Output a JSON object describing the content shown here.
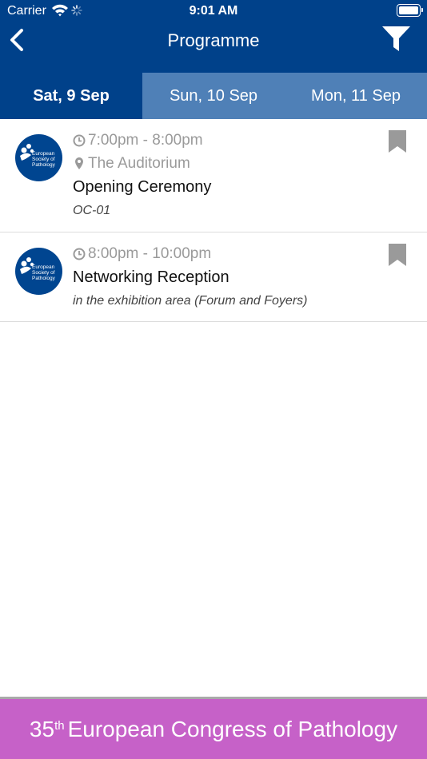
{
  "statusbar": {
    "carrier": "Carrier",
    "time": "9:01 AM"
  },
  "navbar": {
    "title": "Programme",
    "back_icon": "chevron-left-icon",
    "filter_icon": "filter-icon"
  },
  "tabs": [
    {
      "label": "Sat, 9 Sep",
      "active": true
    },
    {
      "label": "Sun, 10 Sep",
      "active": false
    },
    {
      "label": "Mon, 11 Sep",
      "active": false
    }
  ],
  "events": [
    {
      "time": "7:00pm - 8:00pm",
      "location": "The Auditorium",
      "title": "Opening Ceremony",
      "subtitle": "OC-01",
      "logo_text": "European Society of Pathology"
    },
    {
      "time": "8:00pm - 10:00pm",
      "title": "Networking Reception",
      "subtitle": "in the exhibition area (Forum and Foyers)",
      "logo_text": "European Society of Pathology"
    }
  ],
  "footer": {
    "number": "35",
    "ordinal": "th",
    "text": "European Congress of Pathology"
  },
  "colors": {
    "primary": "#00418a",
    "tab_inactive": "#4f80b7",
    "footer": "#c661c8",
    "muted": "#9a9a9a"
  }
}
